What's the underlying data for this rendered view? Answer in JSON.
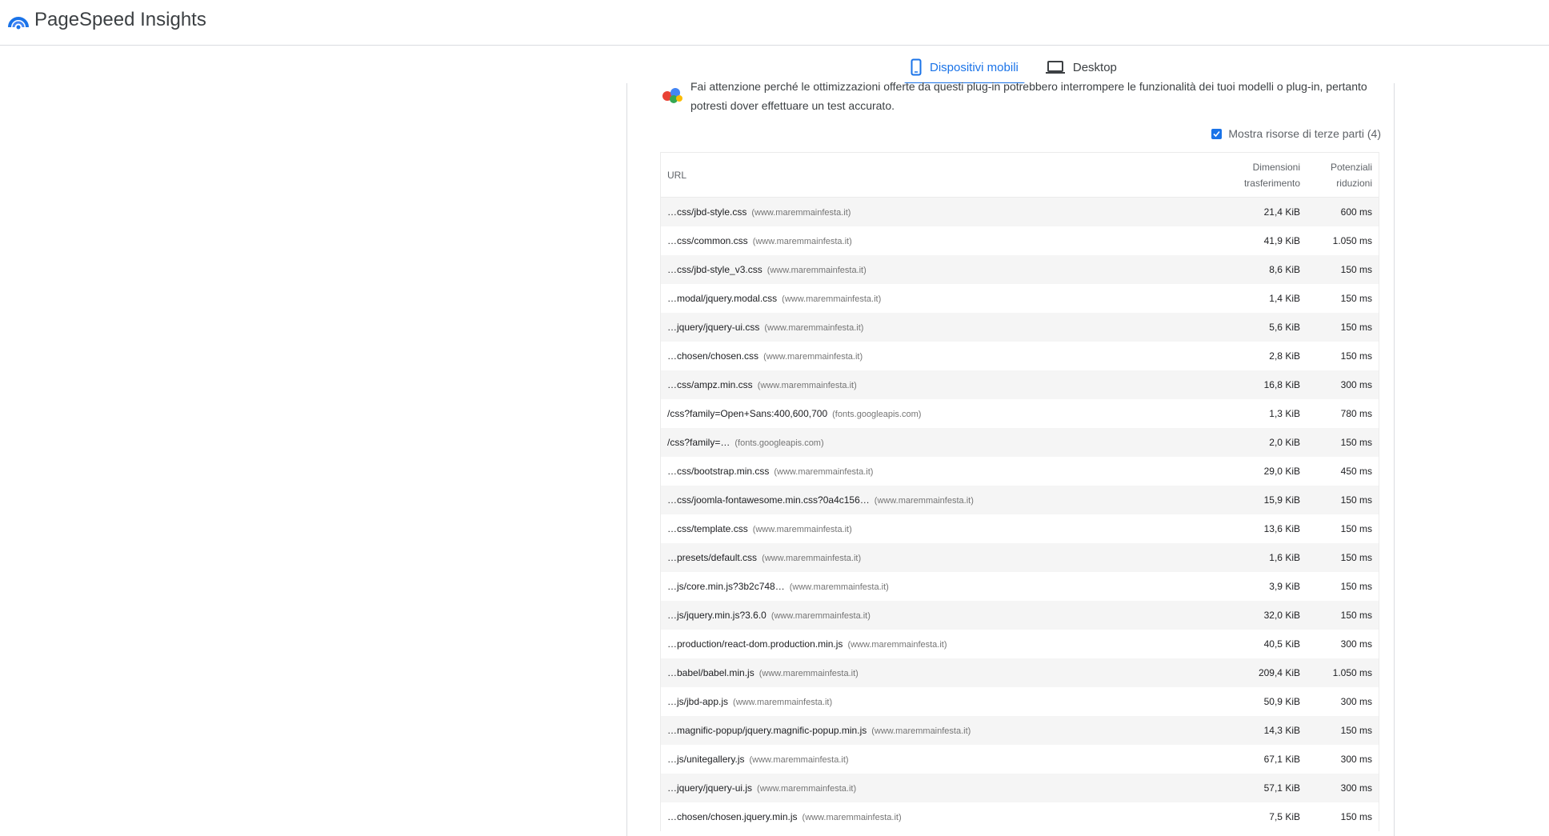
{
  "app": {
    "title": "PageSpeed Insights"
  },
  "tabs": [
    {
      "label": "Dispositivi mobili",
      "icon": "mobile-phone-icon",
      "active": true
    },
    {
      "label": "Desktop",
      "icon": "laptop-icon",
      "active": false
    }
  ],
  "warning": {
    "text": "Fai attenzione perché le ottimizzazioni offerte da questi plug-in potrebbero interrompere le funzionalità dei tuoi modelli o plug-in, pertanto potresti dover effettuare un test accurato."
  },
  "third_party": {
    "label": "Mostra risorse di terze parti (4)",
    "checked": true
  },
  "table": {
    "headers": {
      "url": "URL",
      "size_line1": "Dimensioni",
      "size_line2": "trasferimento",
      "savings_line1": "Potenziali",
      "savings_line2": "riduzioni"
    },
    "rows": [
      {
        "path": "…css/jbd-style.css",
        "host": "(www.maremmainfesta.it)",
        "size": "21,4 KiB",
        "savings": "600 ms"
      },
      {
        "path": "…css/common.css",
        "host": "(www.maremmainfesta.it)",
        "size": "41,9 KiB",
        "savings": "1.050 ms"
      },
      {
        "path": "…css/jbd-style_v3.css",
        "host": "(www.maremmainfesta.it)",
        "size": "8,6 KiB",
        "savings": "150 ms"
      },
      {
        "path": "…modal/jquery.modal.css",
        "host": "(www.maremmainfesta.it)",
        "size": "1,4 KiB",
        "savings": "150 ms"
      },
      {
        "path": "…jquery/jquery-ui.css",
        "host": "(www.maremmainfesta.it)",
        "size": "5,6 KiB",
        "savings": "150 ms"
      },
      {
        "path": "…chosen/chosen.css",
        "host": "(www.maremmainfesta.it)",
        "size": "2,8 KiB",
        "savings": "150 ms"
      },
      {
        "path": "…css/ampz.min.css",
        "host": "(www.maremmainfesta.it)",
        "size": "16,8 KiB",
        "savings": "300 ms"
      },
      {
        "path": "/css?family=Open+Sans:400,600,700",
        "host": "(fonts.googleapis.com)",
        "size": "1,3 KiB",
        "savings": "780 ms"
      },
      {
        "path": "/css?family=…",
        "host": "(fonts.googleapis.com)",
        "size": "2,0 KiB",
        "savings": "150 ms"
      },
      {
        "path": "…css/bootstrap.min.css",
        "host": "(www.maremmainfesta.it)",
        "size": "29,0 KiB",
        "savings": "450 ms"
      },
      {
        "path": "…css/joomla-fontawesome.min.css?0a4c156…",
        "host": "(www.maremmainfesta.it)",
        "size": "15,9 KiB",
        "savings": "150 ms"
      },
      {
        "path": "…css/template.css",
        "host": "(www.maremmainfesta.it)",
        "size": "13,6 KiB",
        "savings": "150 ms"
      },
      {
        "path": "…presets/default.css",
        "host": "(www.maremmainfesta.it)",
        "size": "1,6 KiB",
        "savings": "150 ms"
      },
      {
        "path": "…js/core.min.js?3b2c748…",
        "host": "(www.maremmainfesta.it)",
        "size": "3,9 KiB",
        "savings": "150 ms"
      },
      {
        "path": "…js/jquery.min.js?3.6.0",
        "host": "(www.maremmainfesta.it)",
        "size": "32,0 KiB",
        "savings": "150 ms"
      },
      {
        "path": "…production/react-dom.production.min.js",
        "host": "(www.maremmainfesta.it)",
        "size": "40,5 KiB",
        "savings": "300 ms"
      },
      {
        "path": "…babel/babel.min.js",
        "host": "(www.maremmainfesta.it)",
        "size": "209,4 KiB",
        "savings": "1.050 ms"
      },
      {
        "path": "…js/jbd-app.js",
        "host": "(www.maremmainfesta.it)",
        "size": "50,9 KiB",
        "savings": "300 ms"
      },
      {
        "path": "…magnific-popup/jquery.magnific-popup.min.js",
        "host": "(www.maremmainfesta.it)",
        "size": "14,3 KiB",
        "savings": "150 ms"
      },
      {
        "path": "…js/unitegallery.js",
        "host": "(www.maremmainfesta.it)",
        "size": "67,1 KiB",
        "savings": "300 ms"
      },
      {
        "path": "…jquery/jquery-ui.js",
        "host": "(www.maremmainfesta.it)",
        "size": "57,1 KiB",
        "savings": "300 ms"
      },
      {
        "path": "…chosen/chosen.jquery.min.js",
        "host": "(www.maremmainfesta.it)",
        "size": "7,5 KiB",
        "savings": "150 ms"
      }
    ]
  }
}
